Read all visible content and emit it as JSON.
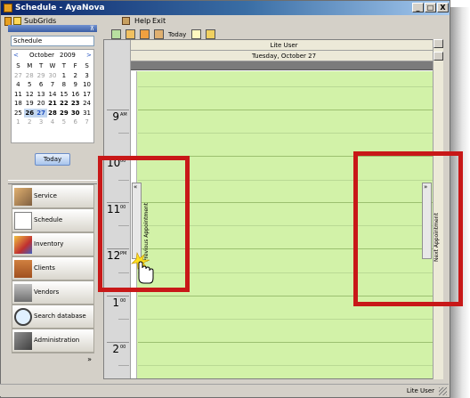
{
  "window": {
    "title": "Schedule - AyaNova"
  },
  "titlebar_buttons": {
    "minimize": "_",
    "maximize": "□",
    "close": "X"
  },
  "menu": {
    "subgrids": "SubGrids",
    "help": "Help",
    "exit": "Exit"
  },
  "toolbar": {
    "today_label": "Today"
  },
  "left_panel": {
    "header_pin": "⊼",
    "view_combo": "Schedule",
    "calendar": {
      "prev": "<",
      "next": ">",
      "month": "October",
      "year": "2009",
      "weekdays": [
        "S",
        "M",
        "T",
        "W",
        "T",
        "F",
        "S"
      ],
      "weeks": [
        [
          "27",
          "28",
          "29",
          "30",
          "1",
          "2",
          "3"
        ],
        [
          "4",
          "5",
          "6",
          "7",
          "8",
          "9",
          "10"
        ],
        [
          "11",
          "12",
          "13",
          "14",
          "15",
          "16",
          "17"
        ],
        [
          "18",
          "19",
          "20",
          "21",
          "22",
          "23",
          "24"
        ],
        [
          "25",
          "26",
          "27",
          "28",
          "29",
          "30",
          "31"
        ],
        [
          "1",
          "2",
          "3",
          "4",
          "5",
          "6",
          "7"
        ]
      ]
    },
    "today_button": "Today"
  },
  "navigation": {
    "items": [
      {
        "label": "Service",
        "icon": "wrench-screwdriver-icon"
      },
      {
        "label": "Schedule",
        "icon": "calendar-icon"
      },
      {
        "label": "Inventory",
        "icon": "shapes-icon"
      },
      {
        "label": "Clients",
        "icon": "house-icon"
      },
      {
        "label": "Vendors",
        "icon": "truck-icon"
      },
      {
        "label": "Search database",
        "icon": "magnifier-icon"
      },
      {
        "label": "Administration",
        "icon": "admin-tools-icon"
      }
    ],
    "footer_chevron": "»"
  },
  "schedule": {
    "user_header": "Lite User",
    "date_header": "Tuesday, October 27",
    "hours": [
      {
        "big": "9",
        "small": "AM"
      },
      {
        "big": "10",
        "small": "00"
      },
      {
        "big": "11",
        "small": "00"
      },
      {
        "big": "12",
        "small": "PM"
      },
      {
        "big": "1",
        "small": "00"
      },
      {
        "big": "2",
        "small": "00"
      }
    ],
    "previous_tab": {
      "label": "Previous Appointment",
      "close": "«"
    },
    "next_tab": {
      "label": "Next Appointment",
      "close": "»"
    }
  },
  "status": {
    "text": "Lite User"
  },
  "colors": {
    "day_background": "#d2f2a8",
    "highlight": "#c81818",
    "title_bar": "#0a246a"
  }
}
